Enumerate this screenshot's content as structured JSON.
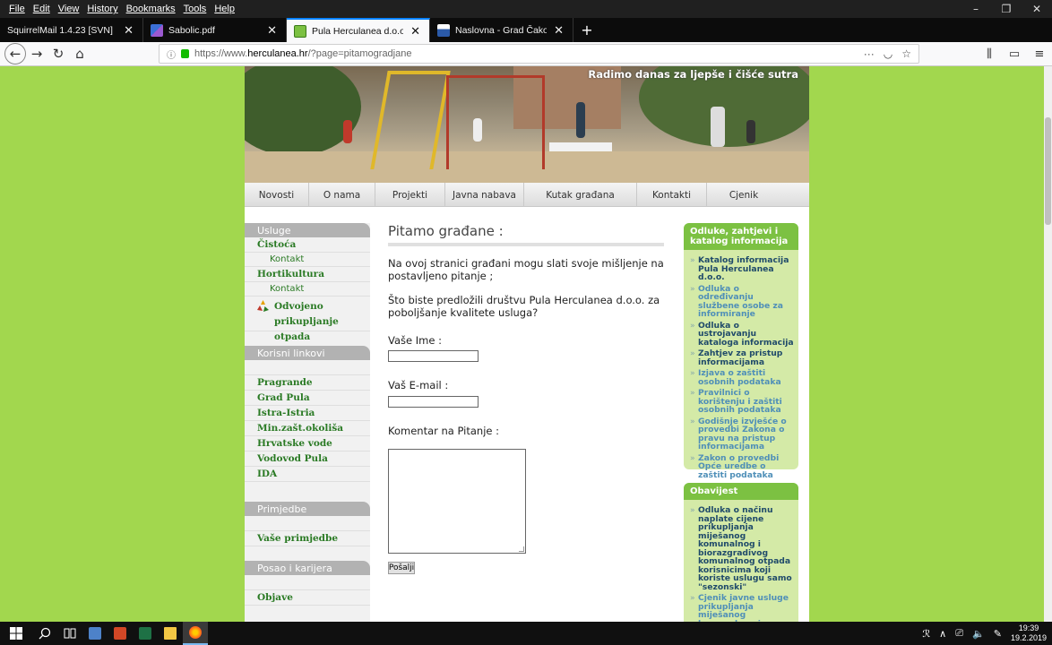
{
  "browser": {
    "menu": [
      "File",
      "Edit",
      "View",
      "History",
      "Bookmarks",
      "Tools",
      "Help"
    ],
    "window_controls": {
      "minimize": "–",
      "restore": "❐",
      "close": "✕"
    },
    "tabs": [
      {
        "title": "SquirrelMail 1.4.23 [SVN]",
        "close": "✕",
        "active": false
      },
      {
        "title": "Sabolic.pdf",
        "close": "✕",
        "active": false
      },
      {
        "title": "Pula Herculanea d.o.o.-za kom",
        "close": "✕",
        "active": true
      },
      {
        "title": "Naslovna - Grad Čakovec",
        "close": "✕",
        "active": false
      }
    ],
    "new_tab": "+",
    "nav": {
      "back": "←",
      "forward": "→",
      "reload": "↻",
      "home": "⌂"
    },
    "url": {
      "prefix": "https://www.",
      "host": "herculanea.hr",
      "path": "/?page=pitamogradjane"
    },
    "url_tools": [
      "···",
      "◡",
      "☆"
    ],
    "toolbar_right": [
      "⫼",
      "▭",
      "≡"
    ]
  },
  "site": {
    "tagline": "Radimo danas za ljepše i čišće sutra",
    "nav": [
      "Novosti",
      "O nama",
      "Projekti",
      "Javna nabava",
      "Kutak građana",
      "Kontakti",
      "Cjenik"
    ],
    "left": {
      "usluge_title": "Usluge",
      "usluge": [
        {
          "label": "Čistoća",
          "kind": "link"
        },
        {
          "label": "Kontakt",
          "kind": "sub"
        },
        {
          "label": "Hortikultura",
          "kind": "link"
        },
        {
          "label": "Kontakt",
          "kind": "sub"
        }
      ],
      "odvojeno_line1": "Odvojeno",
      "odvojeno_line2": "prikupljanje otpada",
      "linkovi_title": "Korisni linkovi",
      "linkovi": [
        "Pragrande",
        "Grad Pula",
        "Istra-Istria",
        "Min.zašt.okoliša",
        "Hrvatske vode",
        "Vodovod Pula",
        "IDA"
      ],
      "primjedbe_title": "Primjedbe",
      "primjedbe_link": "Vaše primjedbe",
      "posao_title": "Posao i karijera",
      "posao_link": "Objave"
    },
    "centre": {
      "title": "Pitamo građane :",
      "intro": "Na ovoj stranici građani mogu slati svoje mišljenje na postavljeno pitanje ;",
      "question": "Što biste predložili društvu Pula Herculanea d.o.o. za poboljšanje kvalitete usluga?",
      "name_label": "Vaše Ime :",
      "email_label": "Vaš E-mail :",
      "comment_label": "Komentar na Pitanje :",
      "submit": "Pošalji"
    },
    "right": {
      "box1_title": "Odluke, zahtjevi i katalog informacija",
      "box1_items": [
        {
          "text": "Katalog informacija Pula Herculanea d.o.o.",
          "tone": "dark"
        },
        {
          "text": "Odluka o određivanju službene osobe za informiranje",
          "tone": "light"
        },
        {
          "text": "Odluka o ustrojavanju kataloga informacija",
          "tone": "dark"
        },
        {
          "text": "Zahtjev za pristup informacijama",
          "tone": "dark"
        },
        {
          "text": "Izjava o zaštiti osobnih podataka",
          "tone": "light"
        },
        {
          "text": "Pravilnici o korištenju i zaštiti osobnih podataka",
          "tone": "light"
        },
        {
          "text": "Godišnje izvješće o provedbi Zakona o pravu na pristup informacijama",
          "tone": "light"
        },
        {
          "text": "Zakon o provedbi Opće uredbe o zaštiti podataka",
          "tone": "light"
        }
      ],
      "box2_title": "Obavijest",
      "box2_items": [
        {
          "text": "Odluka o načinu naplate cijene prikupljanja miješanog komunalnog i biorazgradivog komunalnog otpada korisnicima koji koriste uslugu samo \"sezonski\"",
          "tone": "dark"
        },
        {
          "text": "Cjenik javne usluge prikupljanja miješanog komunalnog i",
          "tone": "light"
        }
      ]
    }
  },
  "taskbar": {
    "tray": [
      "ℛ",
      "∧",
      "⎚",
      "🔈",
      "✎"
    ],
    "time": "19:39",
    "date": "19.2.2019"
  },
  "colors": {
    "page_bg": "#a2d74e",
    "link_green": "#2a7a24",
    "box_head": "#7cc142",
    "box_bg": "#d4eaa7"
  }
}
